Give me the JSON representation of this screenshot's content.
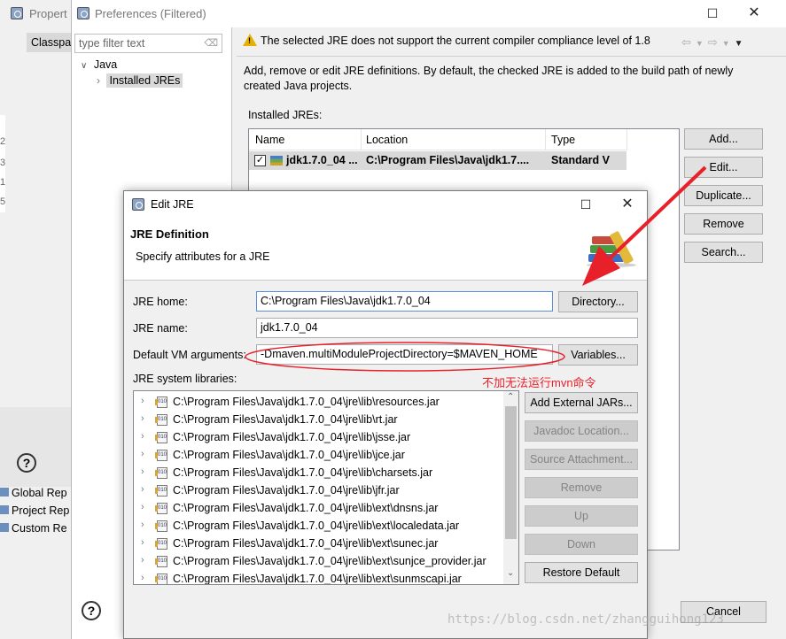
{
  "bg_window": {
    "title": "Propert",
    "tab": "Classpa",
    "left_numbers": [
      "2",
      "3",
      "1",
      "5"
    ],
    "bottom_items": [
      "Global Rep",
      "Project Rep",
      "Custom Re"
    ]
  },
  "prefs": {
    "title": "Preferences (Filtered)",
    "filter_placeholder": "type filter text",
    "tree": {
      "java": "Java",
      "installed_jres": "Installed JREs"
    },
    "warning": "The selected JRE does not support the current compiler compliance level of 1.8",
    "description": [
      "Add, remove or edit JRE definitions. By default, the checked JRE is added to the build path of newly",
      "created Java projects."
    ],
    "installed_label": "Installed JREs:",
    "table": {
      "headers": [
        "Name",
        "Location",
        "Type"
      ],
      "rows": [
        {
          "name": "jdk1.7.0_04 ...",
          "location": "C:\\Program Files\\Java\\jdk1.7....",
          "type": "Standard V",
          "checked": true
        }
      ]
    },
    "buttons": {
      "add": "Add...",
      "edit": "Edit...",
      "duplicate": "Duplicate...",
      "remove": "Remove",
      "search": "Search..."
    },
    "cancel": "Cancel"
  },
  "edit_jre": {
    "title": "Edit JRE",
    "heading": "JRE Definition",
    "subheading": "Specify attributes for a JRE",
    "jre_home_label": "JRE home:",
    "jre_home_value": "C:\\Program Files\\Java\\jdk1.7.0_04",
    "directory_button": "Directory...",
    "jre_name_label": "JRE name:",
    "jre_name_value": "jdk1.7.0_04",
    "vm_args_label": "Default VM arguments:",
    "vm_args_value": "-Dmaven.multiModuleProjectDirectory=$MAVEN_HOME",
    "variables_button": "Variables...",
    "libraries_label": "JRE system libraries:",
    "libraries": [
      "C:\\Program Files\\Java\\jdk1.7.0_04\\jre\\lib\\resources.jar",
      "C:\\Program Files\\Java\\jdk1.7.0_04\\jre\\lib\\rt.jar",
      "C:\\Program Files\\Java\\jdk1.7.0_04\\jre\\lib\\jsse.jar",
      "C:\\Program Files\\Java\\jdk1.7.0_04\\jre\\lib\\jce.jar",
      "C:\\Program Files\\Java\\jdk1.7.0_04\\jre\\lib\\charsets.jar",
      "C:\\Program Files\\Java\\jdk1.7.0_04\\jre\\lib\\jfr.jar",
      "C:\\Program Files\\Java\\jdk1.7.0_04\\jre\\lib\\ext\\dnsns.jar",
      "C:\\Program Files\\Java\\jdk1.7.0_04\\jre\\lib\\ext\\localedata.jar",
      "C:\\Program Files\\Java\\jdk1.7.0_04\\jre\\lib\\ext\\sunec.jar",
      "C:\\Program Files\\Java\\jdk1.7.0_04\\jre\\lib\\ext\\sunjce_provider.jar",
      "C:\\Program Files\\Java\\jdk1.7.0_04\\jre\\lib\\ext\\sunmscapi.jar"
    ],
    "jar_icon_text": "010",
    "side_buttons": {
      "add_external": "Add External JARs...",
      "javadoc": "Javadoc Location...",
      "source": "Source Attachment...",
      "remove": "Remove",
      "up": "Up",
      "down": "Down",
      "restore": "Restore Default"
    },
    "annotation": "不加无法运行mvn命令"
  },
  "watermark": "https://blog.csdn.net/zhangguihong123",
  "colors": {
    "annotation_red": "#e8202a",
    "selection": "#cce8ff",
    "tree_selection": "#d9d9d9"
  }
}
